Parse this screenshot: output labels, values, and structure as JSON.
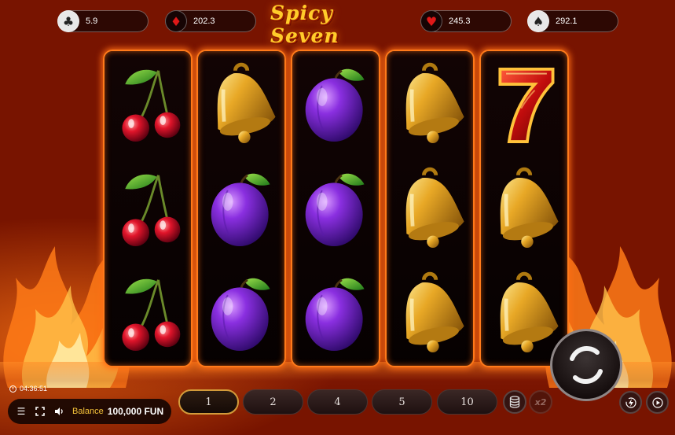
{
  "game_title": "Spicy Seven",
  "stats": [
    {
      "suit": "club-icon",
      "glyph": "♣",
      "value": "5.9"
    },
    {
      "suit": "diamond-icon",
      "glyph": "♦",
      "value": "202.3"
    },
    {
      "suit": "heart-icon",
      "glyph": "♥",
      "value": "245.3"
    },
    {
      "suit": "spade-icon",
      "glyph": "♠",
      "value": "292.1"
    }
  ],
  "reels": [
    [
      "cherry",
      "cherry",
      "cherry"
    ],
    [
      "bell",
      "plum",
      "plum"
    ],
    [
      "plum",
      "plum",
      "plum"
    ],
    [
      "bell",
      "bell",
      "bell"
    ],
    [
      "seven",
      "bell",
      "bell"
    ]
  ],
  "clock": "04:36:51",
  "balance": {
    "label": "Balance",
    "value": "100,000 FUN"
  },
  "bets": [
    {
      "label": "1",
      "active": true
    },
    {
      "label": "2",
      "active": false
    },
    {
      "label": "4",
      "active": false
    },
    {
      "label": "5",
      "active": false
    },
    {
      "label": "10",
      "active": false
    }
  ],
  "multiplier_label": "x2",
  "colors": {
    "reel_glow": "#ff7a1a",
    "title": "#ffcc2a",
    "balance_label": "#f5c43a"
  }
}
